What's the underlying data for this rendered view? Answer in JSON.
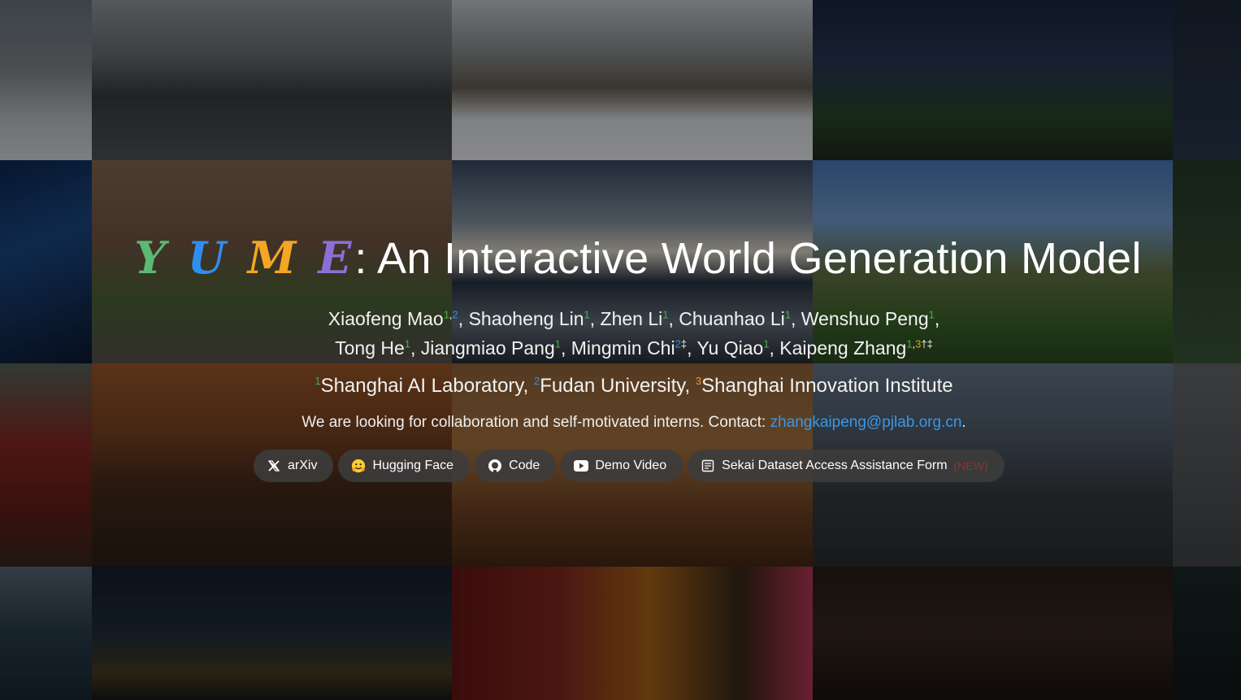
{
  "title": {
    "logo_letters": [
      "Y",
      "U",
      "M",
      "E"
    ],
    "logo_colors": [
      "#5bb974",
      "#2f8ff0",
      "#f5a623",
      "#8b6fd6"
    ],
    "text": ": An Interactive World Generation Model"
  },
  "authors": {
    "line1": [
      {
        "name": "Xiaofeng Mao",
        "sup": [
          {
            "t": "1",
            "c": "green"
          },
          {
            "t": ",",
            "c": "plain"
          },
          {
            "t": "2",
            "c": "blue"
          }
        ],
        "sep": ","
      },
      {
        "name": "Shaoheng Lin",
        "sup": [
          {
            "t": "1",
            "c": "green"
          }
        ],
        "sep": ","
      },
      {
        "name": "Zhen Li",
        "sup": [
          {
            "t": "1",
            "c": "green"
          }
        ],
        "sep": ","
      },
      {
        "name": "Chuanhao Li",
        "sup": [
          {
            "t": "1",
            "c": "green"
          }
        ],
        "sep": ","
      },
      {
        "name": "Wenshuo Peng",
        "sup": [
          {
            "t": "1",
            "c": "green"
          }
        ],
        "sep": ","
      }
    ],
    "line2": [
      {
        "name": "Tong He",
        "sup": [
          {
            "t": "1",
            "c": "green"
          }
        ],
        "sep": ","
      },
      {
        "name": "Jiangmiao Pang",
        "sup": [
          {
            "t": "1",
            "c": "green"
          }
        ],
        "sep": ","
      },
      {
        "name": "Mingmin Chi",
        "sup": [
          {
            "t": "2",
            "c": "blue"
          },
          {
            "t": "‡",
            "c": "plain"
          }
        ],
        "sep": ","
      },
      {
        "name": "Yu Qiao",
        "sup": [
          {
            "t": "1",
            "c": "green"
          }
        ],
        "sep": ","
      },
      {
        "name": "Kaipeng Zhang",
        "sup": [
          {
            "t": "1",
            "c": "green"
          },
          {
            "t": ",",
            "c": "plain"
          },
          {
            "t": "3",
            "c": "orange"
          },
          {
            "t": "†‡",
            "c": "plain"
          }
        ],
        "sep": ""
      }
    ]
  },
  "affiliations": [
    {
      "sup": "1",
      "c": "green",
      "name": "Shanghai AI Laboratory",
      "sep": ", "
    },
    {
      "sup": "2",
      "c": "blue",
      "name": "Fudan University",
      "sep": ", "
    },
    {
      "sup": "3",
      "c": "orange",
      "name": "Shanghai Innovation Institute",
      "sep": ""
    }
  ],
  "contact": {
    "text": "We are looking for collaboration and self-motivated interns. Contact: ",
    "email": "zhangkaipeng@pjlab.org.cn",
    "suffix": "."
  },
  "buttons": [
    {
      "label": "arXiv",
      "icon": "x-logo-icon"
    },
    {
      "label": "Hugging Face",
      "icon": "hugging-face-emoji-icon"
    },
    {
      "label": "Code",
      "icon": "github-icon"
    },
    {
      "label": "Demo Video",
      "icon": "youtube-icon"
    },
    {
      "label": "Sekai Dataset Access Assistance Form",
      "icon": "form-icon",
      "tag": "(NEW)"
    }
  ],
  "colors": {
    "sup_green": "#4caf50",
    "sup_blue": "#3b8ee6",
    "sup_orange": "#e69b2c",
    "link": "#3b97e6",
    "button_bg": "#3c3c3c"
  }
}
